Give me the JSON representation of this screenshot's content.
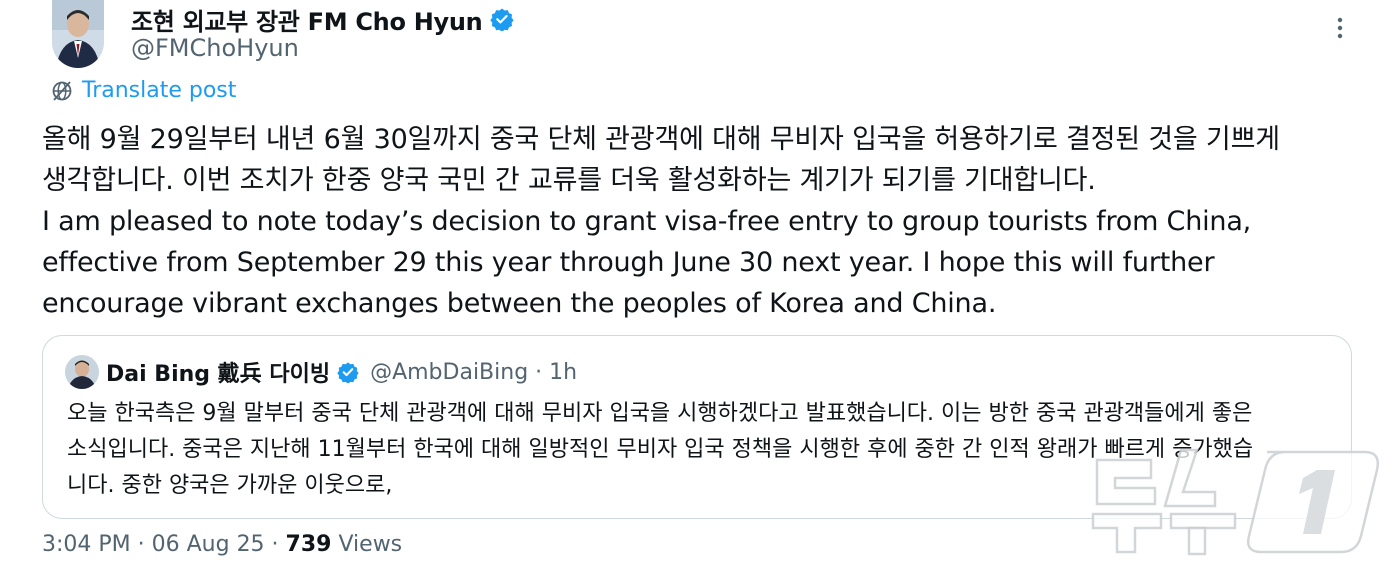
{
  "author": {
    "display_name": "조현 외교부 장관 FM Cho Hyun",
    "handle": "@FMChoHyun"
  },
  "translate_label": "Translate post",
  "tweet_lines": [
    "올해 9월 29일부터 내년 6월 30일까지 중국 단체 관광객에 대해 무비자 입국을 허용하기로 결정된 것을 기쁘게",
    "생각합니다. 이번 조치가 한중 양국 국민 간 교류를 더욱 활성화하는 계기가 되기를 기대합니다.",
    "I am pleased to note today’s decision to grant visa-free entry to group tourists from China,",
    "effective from September 29 this year through June 30 next year. I hope this will further",
    "encourage vibrant exchanges between the peoples of Korea and China."
  ],
  "quote": {
    "display_name": "Dai Bing 戴兵 다이빙",
    "handle": "@AmbDaiBing",
    "separator": "·",
    "time": "1h",
    "lines": [
      "오늘 한국측은 9월 말부터 중국 단체 관광객에 대해 무비자 입국을 시행하겠다고 발표했습니다. 이는 방한 중국 관광객들에게 좋은",
      "소식입니다. 중국은 지난해 11월부터 한국에 대해 일방적인 무비자 입국 정책을 시행한 후에 중한 간 인적 왕래가 빠르게 증가했습",
      "니다. 중한 양국은 가까운 이웃으로,"
    ]
  },
  "meta": {
    "timestamp": "3:04 PM · 06 Aug 25 · ",
    "views_count": "739",
    "views_label": " Views"
  },
  "watermark_text": "뉴스1",
  "colors": {
    "accent": "#1d9bf0",
    "text": "#0f1419",
    "secondary": "#536471",
    "border": "#cfd9de"
  },
  "icons": {
    "verified": "verified-badge-icon",
    "more": "more-options-icon",
    "translate": "globe-translate-icon"
  }
}
